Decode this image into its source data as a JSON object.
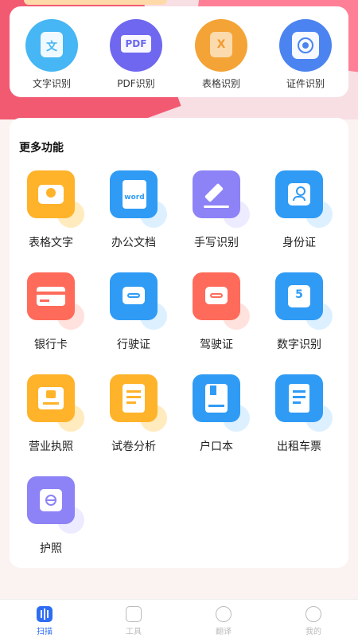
{
  "top_actions": [
    {
      "label": "文字识别",
      "icon": "text-doc-icon",
      "color": "#46b6f4"
    },
    {
      "label": "PDF识别",
      "icon": "pdf-icon",
      "color": "#6f67ef"
    },
    {
      "label": "表格识别",
      "icon": "excel-icon",
      "color": "#f4a436"
    },
    {
      "label": "证件识别",
      "icon": "id-card-icon",
      "color": "#4b84f0"
    }
  ],
  "more": {
    "title": "更多功能",
    "items": [
      {
        "label": "表格文字",
        "icon": "camera-icon",
        "color": "#ffb32a"
      },
      {
        "label": "办公文档",
        "icon": "word-icon",
        "color": "#2f9bf5",
        "word": "word"
      },
      {
        "label": "手写识别",
        "icon": "pen-icon",
        "color": "#8d82f6"
      },
      {
        "label": "身份证",
        "icon": "person-id-icon",
        "color": "#2f9bf5"
      },
      {
        "label": "银行卡",
        "icon": "bank-card-icon",
        "color": "#ff6b5a"
      },
      {
        "label": "行驶证",
        "icon": "car-license-icon",
        "color": "#2f9bf5"
      },
      {
        "label": "驾驶证",
        "icon": "driver-license-icon",
        "color": "#ff6b5a"
      },
      {
        "label": "数字识别",
        "icon": "number-icon",
        "color": "#2f9bf5",
        "digit": "5"
      },
      {
        "label": "营业执照",
        "icon": "business-license-icon",
        "color": "#ffb32a"
      },
      {
        "label": "试卷分析",
        "icon": "exam-icon",
        "color": "#ffb32a"
      },
      {
        "label": "户口本",
        "icon": "household-book-icon",
        "color": "#2f9bf5"
      },
      {
        "label": "出租车票",
        "icon": "taxi-receipt-icon",
        "color": "#2f9bf5"
      },
      {
        "label": "护照",
        "icon": "passport-icon",
        "color": "#8d82f6"
      }
    ]
  },
  "tabs": [
    {
      "label": "扫描",
      "icon": "scan-icon",
      "active": true
    },
    {
      "label": "工具",
      "icon": "tools-icon",
      "active": false
    },
    {
      "label": "翻译",
      "icon": "translate-icon",
      "active": false
    },
    {
      "label": "我的",
      "icon": "profile-icon",
      "active": false
    }
  ]
}
